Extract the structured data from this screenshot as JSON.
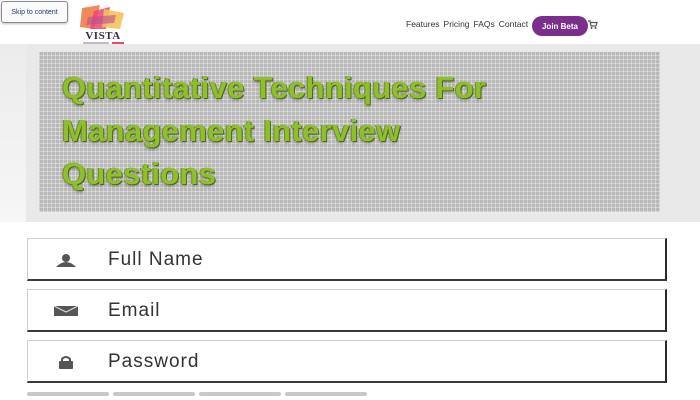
{
  "header": {
    "skip_link": "Skip to content",
    "logo_text": "VISTA",
    "nav": [
      "Features",
      "Pricing",
      "FAQs",
      "Contact"
    ],
    "cta": "Join Beta",
    "cart_icon": "cart-icon"
  },
  "banner": {
    "title_lines": [
      "Quantitative Techniques For",
      "Management Interview",
      "Questions"
    ]
  },
  "form": {
    "full_name": {
      "icon": "user-icon",
      "placeholder": "Full Name"
    },
    "email": {
      "icon": "envelope-icon",
      "placeholder": "Email"
    },
    "password": {
      "icon": "lock-icon",
      "placeholder": "Password"
    }
  },
  "colors": {
    "accent": "#7b2f8c",
    "title": "#8fbf2c"
  }
}
